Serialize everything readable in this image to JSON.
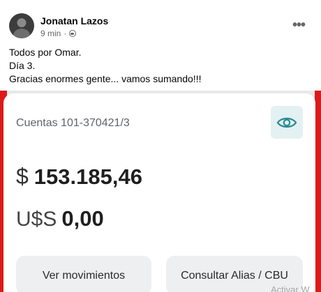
{
  "post": {
    "author": "Jonatan Lazos",
    "time": "9 min",
    "separator": "·",
    "more_label": "•••",
    "lines": [
      "Todos por Omar.",
      "Día 3.",
      "Gracias enormes gente... vamos sumando!!!"
    ]
  },
  "screenshot": {
    "account_label": "Cuentas 101-370421/3",
    "ars": {
      "currency": "$",
      "amount": "153.185,46"
    },
    "usd": {
      "currency": "U$S",
      "amount": "0,00"
    },
    "buttons": {
      "movements": "Ver movimientos",
      "alias": "Consultar Alias / CBU"
    },
    "watermark": "Activar W"
  },
  "colors": {
    "brand_red": "#dc1a1a",
    "eye_bg": "#e3f1f2",
    "eye_icon": "#2a8a93"
  }
}
